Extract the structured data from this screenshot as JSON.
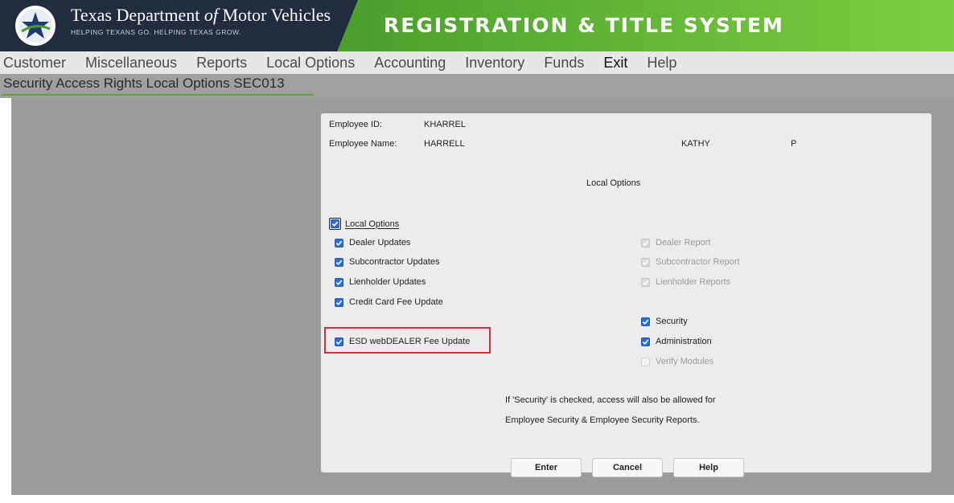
{
  "header": {
    "org_name_part1": "Texas Department ",
    "org_name_italic": "of",
    "org_name_part2": " Motor Vehicles",
    "org_tagline": "HELPING TEXANS GO. HELPING TEXAS GROW.",
    "system_title": "REGISTRATION & TITLE SYSTEM",
    "colors": {
      "navy": "#222c3f",
      "green": "#5eb236"
    }
  },
  "menu": {
    "items": [
      "Customer",
      "Miscellaneous",
      "Reports",
      "Local Options",
      "Accounting",
      "Inventory",
      "Funds",
      "Exit",
      "Help"
    ]
  },
  "page_title": "Security Access Rights Local Options SEC013",
  "employee": {
    "id_label": "Employee ID:",
    "id_value": "KHARREL",
    "name_label": "Employee Name:",
    "last_name": "HARRELL",
    "first_name": "KATHY",
    "middle_initial": "P"
  },
  "section_title": "Local Options",
  "checkboxes": {
    "local_options": {
      "label": "Local Options",
      "checked": true
    },
    "dealer_updates": {
      "label": "Dealer Updates",
      "checked": true
    },
    "subcontractor_updates": {
      "label": "Subcontractor Updates",
      "checked": true
    },
    "lienholder_updates": {
      "label": "Lienholder Updates",
      "checked": true
    },
    "credit_card_fee_update": {
      "label": "Credit Card Fee Update",
      "checked": true
    },
    "esd_webdealer_fee_update": {
      "label": "ESD webDEALER Fee Update",
      "checked": true
    },
    "dealer_report": {
      "label": "Dealer Report",
      "checked": true,
      "disabled": true
    },
    "subcontractor_report": {
      "label": "Subcontractor Report",
      "checked": true,
      "disabled": true
    },
    "lienholder_reports": {
      "label": "Lienholder Reports",
      "checked": true,
      "disabled": true
    },
    "security": {
      "label": "Security",
      "checked": true
    },
    "administration": {
      "label": "Administration",
      "checked": true
    },
    "verify_modules": {
      "label": "Verify Modules",
      "checked": false,
      "disabled": true
    }
  },
  "note": {
    "line1": "If 'Security' is checked, access will also be allowed for",
    "line2": "Employee Security & Employee Security Reports."
  },
  "buttons": {
    "enter": "Enter",
    "cancel": "Cancel",
    "help": "Help"
  },
  "colors": {
    "highlight_red": "#d32f3a",
    "checkbox_blue": "#2a6fd6"
  }
}
